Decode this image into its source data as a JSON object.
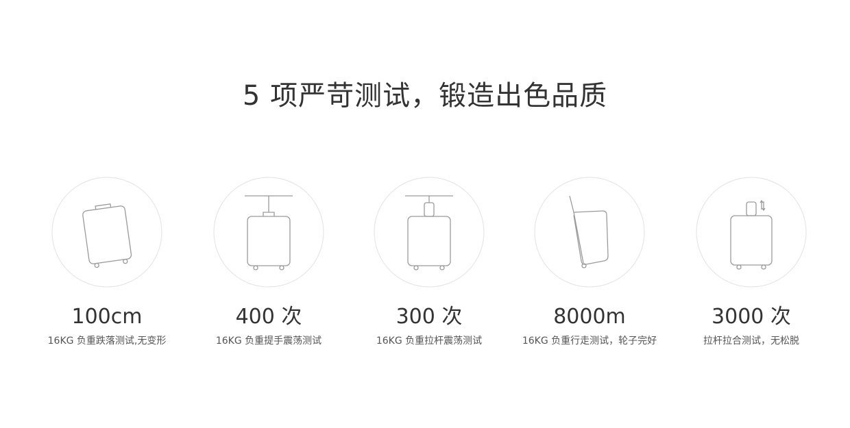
{
  "page_title": "5 项严苛测试，锻造出色品质",
  "features": [
    {
      "value": "100cm",
      "desc": "16KG 负重跌落测试,无变形",
      "icon": "tilted-suitcase-drop-icon"
    },
    {
      "value": "400 次",
      "desc": "16KG 负重提手震荡测试",
      "icon": "suitcase-handle-hanging-icon"
    },
    {
      "value": "300 次",
      "desc": "16KG 负重拉杆震荡测试",
      "icon": "suitcase-trolley-hanging-icon"
    },
    {
      "value": "8000m",
      "desc": "16KG 负重行走测试，轮子完好",
      "icon": "suitcase-rolling-icon"
    },
    {
      "value": "3000 次",
      "desc": "拉杆拉合测试，无松脱",
      "icon": "suitcase-handle-retract-icon"
    }
  ],
  "colors": {
    "circle_stroke": "#e2e2e2",
    "icon_stroke": "#9a9a9a",
    "title_text": "#333333",
    "desc_text": "#555555"
  }
}
